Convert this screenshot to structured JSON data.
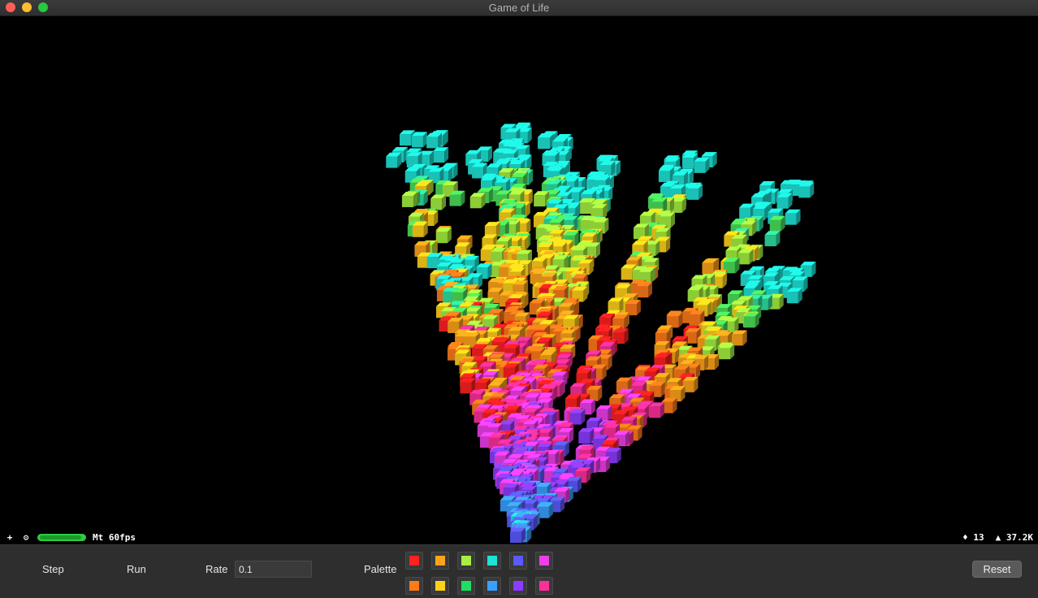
{
  "window": {
    "title": "Game of Life"
  },
  "hud": {
    "left_icons": [
      "+",
      "⚙"
    ],
    "fps_level": 0.95,
    "fps_text": "Mt 60fps",
    "right_items": [
      "♦ 13",
      "▲ 37.2K"
    ]
  },
  "controls": {
    "step_label": "Step",
    "run_label": "Run",
    "rate_label": "Rate",
    "rate_value": "0.1",
    "palette_label": "Palette",
    "palette_row1": [
      "#ff2020",
      "#ffa31a",
      "#a5f040",
      "#1de3d6",
      "#5a5aff",
      "#ee3ee8"
    ],
    "palette_row2": [
      "#ff7a1a",
      "#ffd21a",
      "#1de060",
      "#3aa0ff",
      "#8a3cff",
      "#ff2f9a"
    ],
    "reset_label": "Reset"
  },
  "scene_colors": [
    "#1de3d6",
    "#2fe0a0",
    "#4ae05a",
    "#a5f040",
    "#ffd21a",
    "#ffa31a",
    "#ff7a1a",
    "#ff2020",
    "#ff2f9a",
    "#ee3ee8",
    "#8a3cff",
    "#5a5aff",
    "#3aa0ff"
  ]
}
